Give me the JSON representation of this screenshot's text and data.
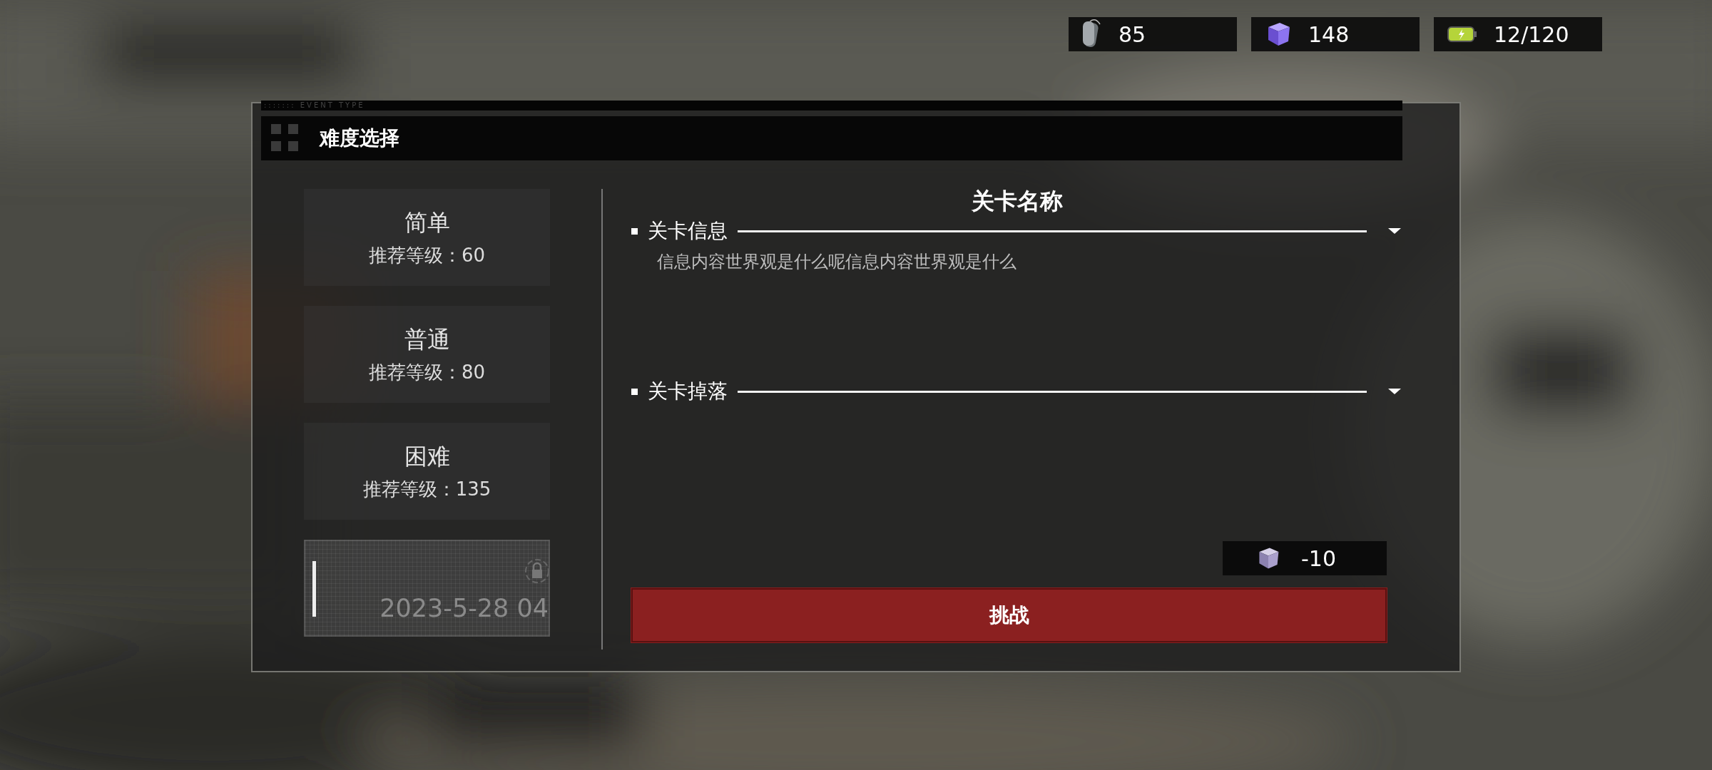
{
  "resources": [
    {
      "kind": "tag",
      "value": "85"
    },
    {
      "kind": "cube",
      "value": "148"
    },
    {
      "kind": "battery",
      "value": "12/120"
    }
  ],
  "dialog": {
    "caption": "::::::: EVENT TYPE",
    "title": "难度选择",
    "difficulties": [
      {
        "kind": "level",
        "name": "简单",
        "level_text": "推荐等级：60",
        "selected": false
      },
      {
        "kind": "level",
        "name": "普通",
        "level_text": "推荐等级：80",
        "selected": false
      },
      {
        "kind": "level",
        "name": "困难",
        "level_text": "推荐等级：135",
        "selected": false
      },
      {
        "kind": "locked",
        "date": "2023-5-28 04",
        "selected": false
      }
    ],
    "stage_title": "关卡名称",
    "sections": [
      {
        "title": "关卡信息",
        "body": "信息内容世界观是什么呢信息内容世界观是什么"
      },
      {
        "title": "关卡掉落"
      }
    ],
    "cost": {
      "kind": "cube",
      "value": "-10"
    },
    "action": "挑战"
  }
}
